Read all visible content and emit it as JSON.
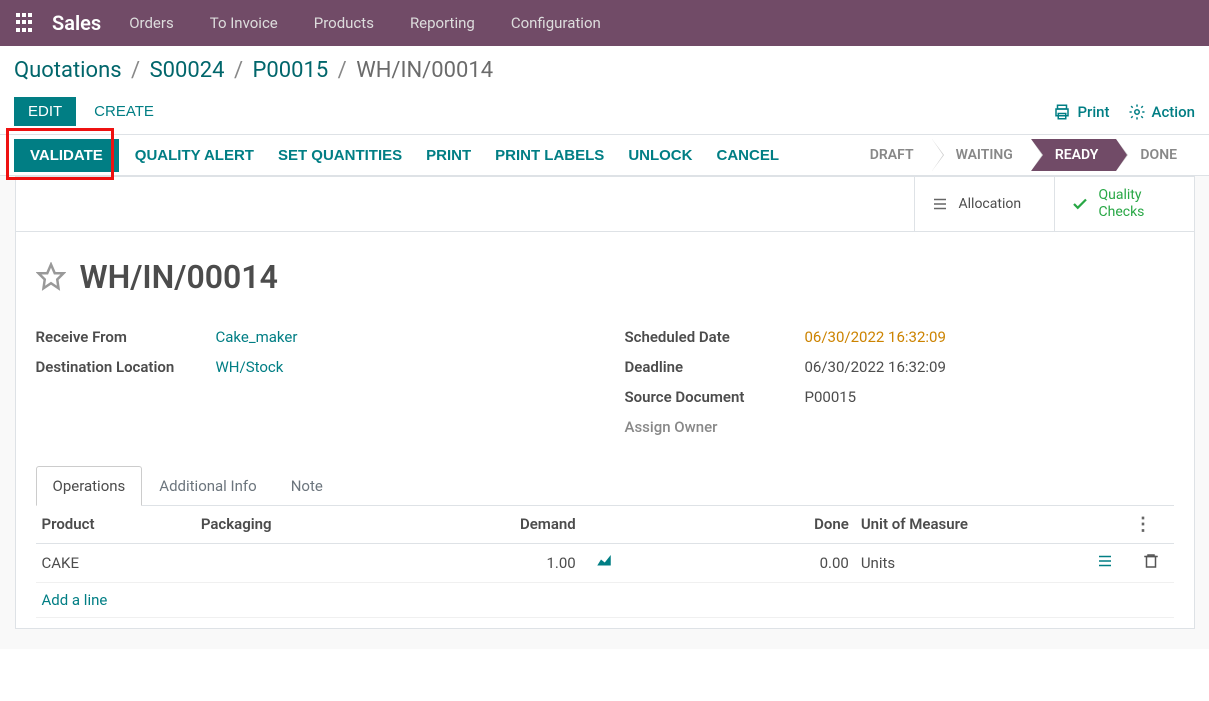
{
  "topnav": {
    "brand": "Sales",
    "items": [
      "Orders",
      "To Invoice",
      "Products",
      "Reporting",
      "Configuration"
    ]
  },
  "breadcrumb": {
    "parts": [
      "Quotations",
      "S00024",
      "P00015"
    ],
    "current": "WH/IN/00014"
  },
  "toolbar": {
    "edit": "EDIT",
    "create": "CREATE",
    "print": "Print",
    "action": "Action"
  },
  "statusbar": {
    "buttons": [
      "VALIDATE",
      "QUALITY ALERT",
      "SET QUANTITIES",
      "PRINT",
      "PRINT LABELS",
      "UNLOCK",
      "CANCEL"
    ],
    "stages": [
      "DRAFT",
      "WAITING",
      "READY",
      "DONE"
    ],
    "active_stage": "READY"
  },
  "stat_buttons": {
    "allocation": "Allocation",
    "quality_checks": "Quality Checks"
  },
  "doc": {
    "title": "WH/IN/00014",
    "receive_from_label": "Receive From",
    "receive_from": "Cake_maker",
    "destination_label": "Destination Location",
    "destination": "WH/Stock",
    "scheduled_date_label": "Scheduled Date",
    "scheduled_date": "06/30/2022 16:32:09",
    "deadline_label": "Deadline",
    "deadline": "06/30/2022 16:32:09",
    "source_doc_label": "Source Document",
    "source_doc": "P00015",
    "assign_owner_label": "Assign Owner"
  },
  "tabs": [
    "Operations",
    "Additional Info",
    "Note"
  ],
  "table": {
    "headers": {
      "product": "Product",
      "packaging": "Packaging",
      "demand": "Demand",
      "done": "Done",
      "uom": "Unit of Measure"
    },
    "rows": [
      {
        "product": "CAKE",
        "packaging": "",
        "demand": "1.00",
        "done": "0.00",
        "uom": "Units"
      }
    ],
    "add_line": "Add a line"
  }
}
